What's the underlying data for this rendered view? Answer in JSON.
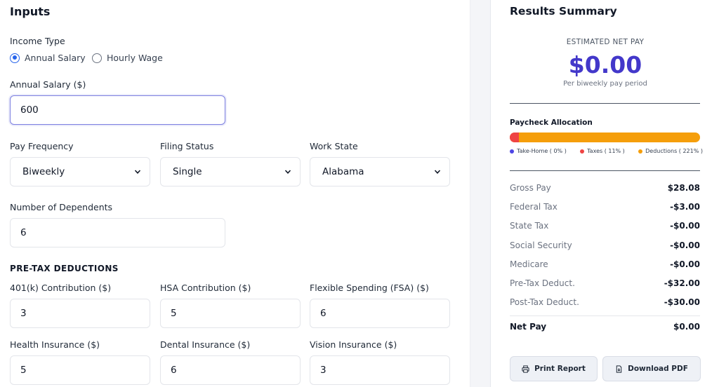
{
  "inputs": {
    "title": "Inputs",
    "income_type": {
      "label": "Income Type",
      "options": [
        "Annual Salary",
        "Hourly Wage"
      ],
      "selected": "Annual Salary"
    },
    "annual_salary": {
      "label": "Annual Salary ($)",
      "value": "600"
    },
    "pay_frequency": {
      "label": "Pay Frequency",
      "value": "Biweekly"
    },
    "filing_status": {
      "label": "Filing Status",
      "value": "Single"
    },
    "work_state": {
      "label": "Work State",
      "value": "Alabama"
    },
    "dependents": {
      "label": "Number of Dependents",
      "value": "6"
    },
    "pretax": {
      "title": "PRE-TAX DEDUCTIONS",
      "k401": {
        "label": "401(k) Contribution ($)",
        "value": "3"
      },
      "hsa": {
        "label": "HSA Contribution ($)",
        "value": "5"
      },
      "fsa": {
        "label": "Flexible Spending (FSA) ($)",
        "value": "6"
      },
      "health": {
        "label": "Health Insurance ($)",
        "value": "5"
      },
      "dental": {
        "label": "Dental Insurance ($)",
        "value": "6"
      },
      "vision": {
        "label": "Vision Insurance ($)",
        "value": "3"
      }
    }
  },
  "results": {
    "title": "Results Summary",
    "estimated_label": "ESTIMATED NET PAY",
    "net_pay": "$0.00",
    "per_period": "Per biweekly pay period",
    "allocation": {
      "title": "Paycheck Allocation",
      "take_home_pct": 0,
      "taxes_pct": 11,
      "deductions_pct": 221,
      "legend": {
        "take_home": "Take-Home ( 0% )",
        "taxes": "Taxes ( 11% )",
        "deductions": "Deductions ( 221% )"
      },
      "colors": {
        "take_home": "#4f46e5",
        "taxes": "#ef4444",
        "deductions": "#f59e0b"
      }
    },
    "rows": [
      {
        "label": "Gross Pay",
        "value": "$28.08"
      },
      {
        "label": "Federal Tax",
        "value": "-$3.00"
      },
      {
        "label": "State Tax",
        "value": "-$0.00"
      },
      {
        "label": "Social Security",
        "value": "-$0.00"
      },
      {
        "label": "Medicare",
        "value": "-$0.00"
      },
      {
        "label": "Pre-Tax Deduct.",
        "value": "-$32.00"
      },
      {
        "label": "Post-Tax Deduct.",
        "value": "-$30.00"
      }
    ],
    "total": {
      "label": "Net Pay",
      "value": "$0.00"
    },
    "buttons": {
      "print": "Print Report",
      "download": "Download PDF"
    },
    "icons": {
      "print": "printer-icon",
      "download": "document-download-icon"
    }
  }
}
